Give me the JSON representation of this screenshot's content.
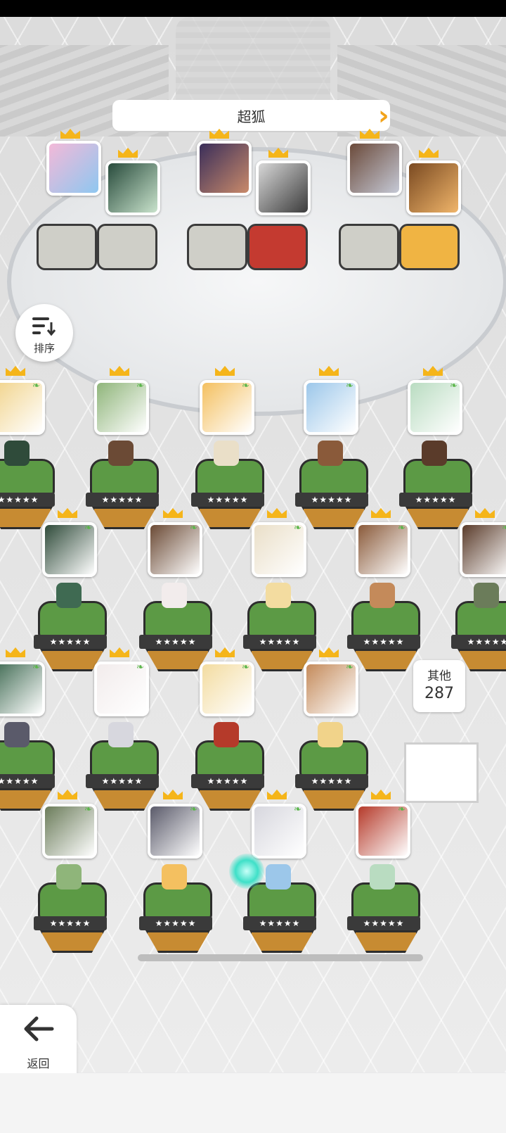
{
  "title": "超狐",
  "sort_button": {
    "label": "排序",
    "icon": "sort-descending-icon"
  },
  "lineup": {
    "slots": [
      {
        "pos": 1,
        "pedestal": "stone"
      },
      {
        "pos": 2,
        "pedestal": "stone"
      },
      {
        "pos": 3,
        "pedestal": "stone"
      },
      {
        "pos": 4,
        "pedestal": "red"
      },
      {
        "pos": 5,
        "pedestal": "stone"
      },
      {
        "pos": 6,
        "pedestal": "gold"
      }
    ]
  },
  "rating_stars": "★★★★★",
  "other": {
    "label": "其他",
    "count": "287"
  },
  "back_button": {
    "label": "返回",
    "icon": "arrow-left-icon"
  },
  "colors": {
    "accent": "#f2a31a",
    "pedestal_green": "#5c9a45",
    "pedestal_base": "#c78b32"
  }
}
